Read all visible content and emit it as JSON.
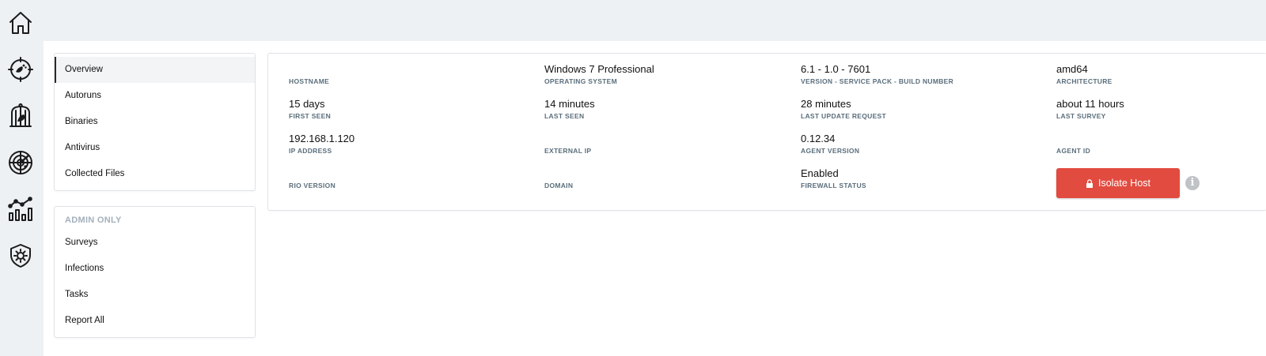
{
  "rail": {
    "icons": [
      "home-icon",
      "crosshair-footprint-icon",
      "birdcage-icon",
      "radar-icon",
      "analytics-chart-icon",
      "shield-gear-icon"
    ]
  },
  "menu": {
    "items": [
      "Overview",
      "Autoruns",
      "Binaries",
      "Antivirus",
      "Collected Files"
    ],
    "active": "Overview"
  },
  "admin": {
    "heading": "ADMIN ONLY",
    "items": [
      "Surveys",
      "Infections",
      "Tasks",
      "Report All"
    ]
  },
  "host": {
    "hostname": {
      "label": "HOSTNAME",
      "value": ""
    },
    "os": {
      "label": "OPERATING SYSTEM",
      "value": "Windows 7 Professional"
    },
    "version": {
      "label": "VERSION - SERVICE PACK - BUILD NUMBER",
      "value": "6.1 - 1.0 - 7601"
    },
    "architecture": {
      "label": "ARCHITECTURE",
      "value": "amd64"
    },
    "first_seen": {
      "label": "FIRST SEEN",
      "value": "15 days"
    },
    "last_seen": {
      "label": "LAST SEEN",
      "value": "14 minutes"
    },
    "last_update_request": {
      "label": "LAST UPDATE REQUEST",
      "value": "28 minutes"
    },
    "last_survey": {
      "label": "LAST SURVEY",
      "value": "about 11 hours"
    },
    "ip_address": {
      "label": "IP ADDRESS",
      "value": "192.168.1.120"
    },
    "external_ip": {
      "label": "EXTERNAL IP",
      "value": ""
    },
    "agent_version": {
      "label": "AGENT VERSION",
      "value": "0.12.34"
    },
    "agent_id": {
      "label": "AGENT ID",
      "value": ""
    },
    "rio_version": {
      "label": "RIO VERSION",
      "value": ""
    },
    "domain": {
      "label": "DOMAIN",
      "value": ""
    },
    "firewall_status": {
      "label": "FIREWALL STATUS",
      "value": "Enabled"
    }
  },
  "actions": {
    "isolate_label": "Isolate Host",
    "isolate_color": "#e24b3f",
    "info_glyph": "i"
  }
}
